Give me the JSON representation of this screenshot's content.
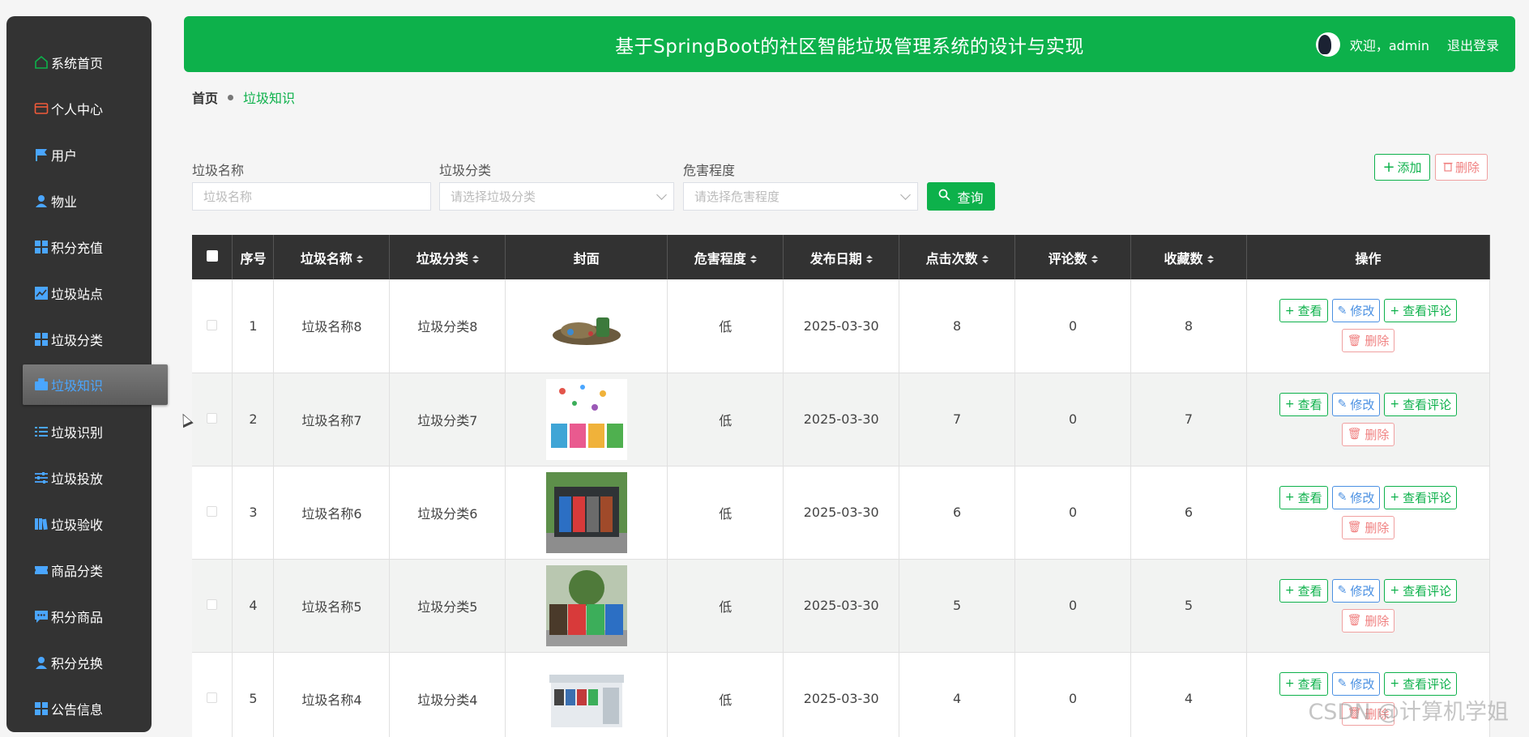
{
  "sidebar": {
    "items": [
      {
        "label": "系统首页",
        "icon": "home-icon",
        "color": "#0db14b"
      },
      {
        "label": "个人中心",
        "icon": "wallet-icon",
        "color": "#f05a3a"
      },
      {
        "label": "用户",
        "icon": "flag-icon",
        "color": "#4aa6ff"
      },
      {
        "label": "物业",
        "icon": "person-icon",
        "color": "#4aa6ff"
      },
      {
        "label": "积分充值",
        "icon": "grid-icon",
        "color": "#4aa6ff"
      },
      {
        "label": "垃圾站点",
        "icon": "chart-icon",
        "color": "#4aa6ff"
      },
      {
        "label": "垃圾分类",
        "icon": "grid-icon",
        "color": "#4aa6ff"
      },
      {
        "label": "垃圾知识",
        "icon": "briefcase-icon",
        "color": "#4aa6ff",
        "active": true
      },
      {
        "label": "垃圾识别",
        "icon": "list-icon",
        "color": "#4aa6ff"
      },
      {
        "label": "垃圾投放",
        "icon": "sliders-icon",
        "color": "#4aa6ff"
      },
      {
        "label": "垃圾验收",
        "icon": "book-icon",
        "color": "#4aa6ff"
      },
      {
        "label": "商品分类",
        "icon": "ticket-icon",
        "color": "#4aa6ff"
      },
      {
        "label": "积分商品",
        "icon": "message-icon",
        "color": "#4aa6ff"
      },
      {
        "label": "积分兑换",
        "icon": "person-icon",
        "color": "#4aa6ff"
      },
      {
        "label": "公告信息",
        "icon": "grid-icon",
        "color": "#4aa6ff"
      }
    ]
  },
  "header": {
    "title": "基于SpringBoot的社区智能垃圾管理系统的设计与实现",
    "welcome": "欢迎，admin",
    "logout": "退出登录"
  },
  "breadcrumb": {
    "home": "首页",
    "current": "垃圾知识"
  },
  "search": {
    "name_label": "垃圾名称",
    "name_placeholder": "垃圾名称",
    "category_label": "垃圾分类",
    "category_placeholder": "请选择垃圾分类",
    "hazard_label": "危害程度",
    "hazard_placeholder": "请选择危害程度",
    "search_button": "查询",
    "add_button": "添加",
    "delete_button": "删除"
  },
  "table": {
    "headers": [
      "序号",
      "垃圾名称",
      "垃圾分类",
      "封面",
      "危害程度",
      "发布日期",
      "点击次数",
      "评论数",
      "收藏数",
      "操作"
    ],
    "actions": {
      "view": "查看",
      "edit": "修改",
      "comment": "查看评论",
      "delete": "删除"
    },
    "rows": [
      {
        "no": "1",
        "name": "垃圾名称8",
        "category": "垃圾分类8",
        "hazard": "低",
        "date": "2025-03-30",
        "clicks": "8",
        "comments": "0",
        "favorites": "8"
      },
      {
        "no": "2",
        "name": "垃圾名称7",
        "category": "垃圾分类7",
        "hazard": "低",
        "date": "2025-03-30",
        "clicks": "7",
        "comments": "0",
        "favorites": "7"
      },
      {
        "no": "3",
        "name": "垃圾名称6",
        "category": "垃圾分类6",
        "hazard": "低",
        "date": "2025-03-30",
        "clicks": "6",
        "comments": "0",
        "favorites": "6"
      },
      {
        "no": "4",
        "name": "垃圾名称5",
        "category": "垃圾分类5",
        "hazard": "低",
        "date": "2025-03-30",
        "clicks": "5",
        "comments": "0",
        "favorites": "5"
      },
      {
        "no": "5",
        "name": "垃圾名称4",
        "category": "垃圾分类4",
        "hazard": "低",
        "date": "2025-03-30",
        "clicks": "4",
        "comments": "0",
        "favorites": "4"
      }
    ]
  },
  "watermark": "CSDN @计算机学姐",
  "colors": {
    "primary": "#0db14b",
    "sidebar_bg": "#333333",
    "active_text": "#4aa6ff",
    "danger": "#f08080",
    "edit": "#4a90e2"
  }
}
